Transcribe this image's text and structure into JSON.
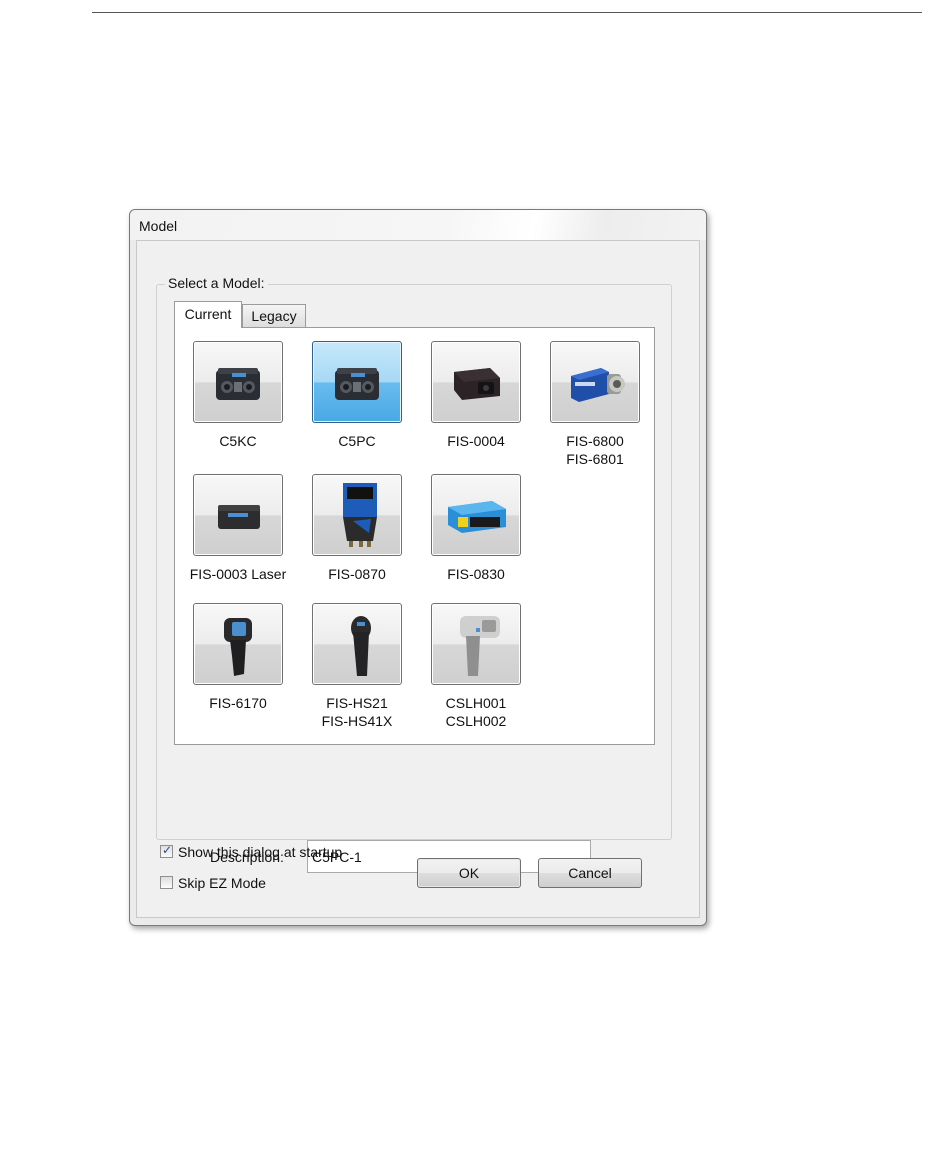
{
  "dialog": {
    "title": "Model",
    "group_label": "Select a Model:",
    "tabs": [
      {
        "label": "Current",
        "active": true
      },
      {
        "label": "Legacy",
        "active": false
      }
    ],
    "models": [
      {
        "label": "C5KC",
        "icon": "smart-camera-c5kc-icon",
        "selected": false
      },
      {
        "label": "C5PC",
        "icon": "smart-camera-c5pc-icon",
        "selected": true
      },
      {
        "label": "FIS-0004",
        "icon": "compact-camera-fis0004-icon",
        "selected": false
      },
      {
        "label": "FIS-6800\nFIS-6801",
        "icon": "blue-imager-fis6800-icon",
        "selected": false
      },
      {
        "label": "FIS-0003 Laser",
        "icon": "laser-scanner-fis0003-icon",
        "selected": false
      },
      {
        "label": "FIS-0870",
        "icon": "fixed-scanner-fis0870-icon",
        "selected": false
      },
      {
        "label": "FIS-0830",
        "icon": "fixed-scanner-fis0830-icon",
        "selected": false
      },
      {
        "label": "FIS-6170",
        "icon": "handheld-scanner-fis6170-icon",
        "selected": false
      },
      {
        "label": "FIS-HS21\nFIS-HS41X",
        "icon": "handheld-scanner-hs21-icon",
        "selected": false
      },
      {
        "label": "CSLH001\nCSLH002",
        "icon": "handheld-scanner-cslh-icon",
        "selected": false
      }
    ],
    "description_label": "Description:",
    "description_value": "C5PC-1",
    "show_dialog_label": "Show this dialog at startup",
    "show_dialog_checked": true,
    "skip_ez_label": "Skip EZ Mode",
    "skip_ez_checked": false,
    "ok_label": "OK",
    "cancel_label": "Cancel",
    "selection_color": "#49a8e4"
  }
}
